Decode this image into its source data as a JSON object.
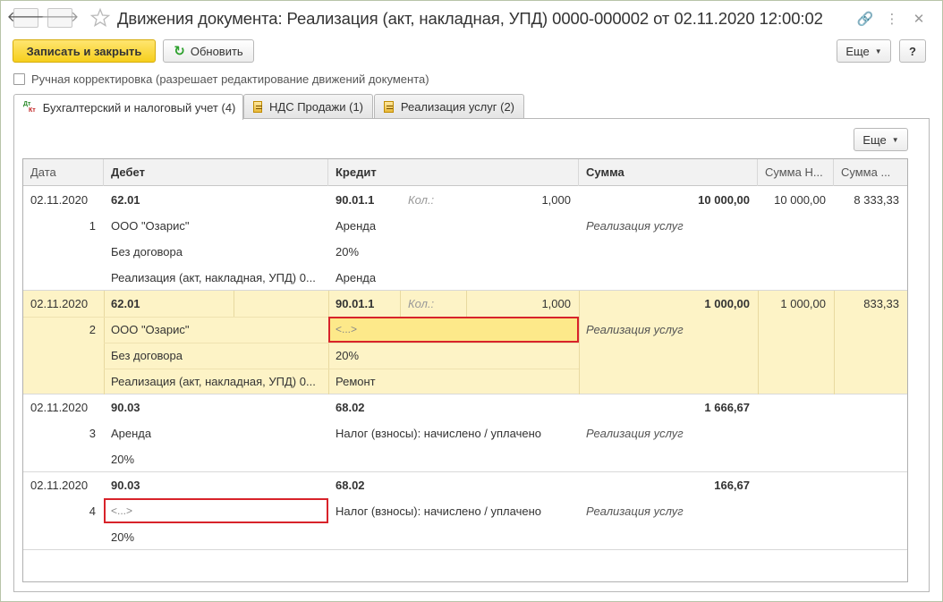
{
  "window": {
    "title": "Движения документа: Реализация (акт, накладная, УПД) 0000-000002 от 02.11.2020 12:00:02",
    "back_glyph": "🡐",
    "forward_glyph": "🡒",
    "link_glyph": "🔗",
    "more_glyph": "⋮",
    "close_glyph": "✕"
  },
  "toolbar": {
    "save_close_label": "Записать и закрыть",
    "refresh_label": "Обновить",
    "refresh_glyph": "↻",
    "more_label": "Еще",
    "help_label": "?"
  },
  "manual_edit": {
    "label": "Ручная корректировка (разрешает редактирование движений документа)",
    "checked": false
  },
  "tabs": [
    {
      "label": "Бухгалтерский и налоговый учет (4)",
      "icon": "dt-kt-icon",
      "active": true
    },
    {
      "label": "НДС Продажи (1)",
      "icon": "register-icon",
      "active": false
    },
    {
      "label": "Реализация услуг (2)",
      "icon": "register-icon",
      "active": false
    }
  ],
  "dt_kt": {
    "dt": "Дт",
    "kt": "Кт"
  },
  "table_more_label": "Еще",
  "columns": [
    "Дата",
    "Дебет",
    "Кредит",
    "Сумма",
    "Сумма Н...",
    "Сумма ..."
  ],
  "rows": [
    {
      "date": "02.11.2020",
      "num": "1",
      "debit": [
        "62.01",
        "ООО \"Озарис\"",
        "Без договора",
        "Реализация (акт, накладная, УПД) 0..."
      ],
      "credit": [
        "90.01.1",
        "Аренда",
        "20%",
        "Аренда"
      ],
      "qty_label": "Кол.:",
      "qty": "1,000",
      "sum": "10 000,00",
      "sum_desc": "Реализация услуг",
      "sum_n": "10 000,00",
      "sum_other": "8 333,33"
    },
    {
      "date": "02.11.2020",
      "num": "2",
      "debit": [
        "62.01",
        "ООО \"Озарис\"",
        "Без договора",
        "Реализация (акт, накладная, УПД) 0..."
      ],
      "credit": [
        "90.01.1",
        "<...>",
        "20%",
        "Ремонт"
      ],
      "qty_label": "Кол.:",
      "qty": "1,000",
      "sum": "1 000,00",
      "sum_desc": "Реализация услуг",
      "sum_n": "1 000,00",
      "sum_other": "833,33"
    },
    {
      "date": "02.11.2020",
      "num": "3",
      "debit": [
        "90.03",
        "Аренда",
        "20%"
      ],
      "credit": [
        "68.02",
        "Налог (взносы): начислено / уплачено"
      ],
      "sum": "1 666,67",
      "sum_desc": "Реализация услуг"
    },
    {
      "date": "02.11.2020",
      "num": "4",
      "debit": [
        "90.03",
        "<...>",
        "20%"
      ],
      "credit": [
        "68.02",
        "Налог (взносы): начислено / уплачено"
      ],
      "sum": "166,67",
      "sum_desc": "Реализация услуг"
    }
  ]
}
